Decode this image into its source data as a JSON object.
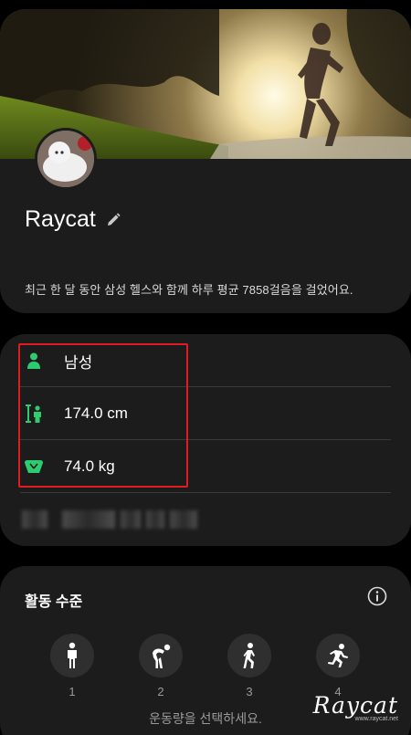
{
  "profile": {
    "name": "Raycat",
    "summary": "최근 한 달 동안 삼성 헬스와 함께 하루 평균 7858걸음을 걸었어요."
  },
  "body_info": [
    {
      "icon": "person-icon",
      "value": "남성"
    },
    {
      "icon": "height-icon",
      "value": "174.0 cm"
    },
    {
      "icon": "weight-scale-icon",
      "value": "74.0 kg"
    }
  ],
  "activity": {
    "title": "활동 수준",
    "levels": [
      {
        "icon": "standing-figure-icon",
        "label": "1"
      },
      {
        "icon": "stretching-figure-icon",
        "label": "2"
      },
      {
        "icon": "walking-figure-icon",
        "label": "3"
      },
      {
        "icon": "running-figure-icon",
        "label": "4"
      }
    ],
    "hint": "운동량을 선택하세요."
  },
  "watermark": {
    "brand": "Raycat",
    "url": "www.raycat.net"
  },
  "colors": {
    "accent": "#2ecc71",
    "highlight": "#e01b22",
    "card": "#1c1c1c"
  }
}
